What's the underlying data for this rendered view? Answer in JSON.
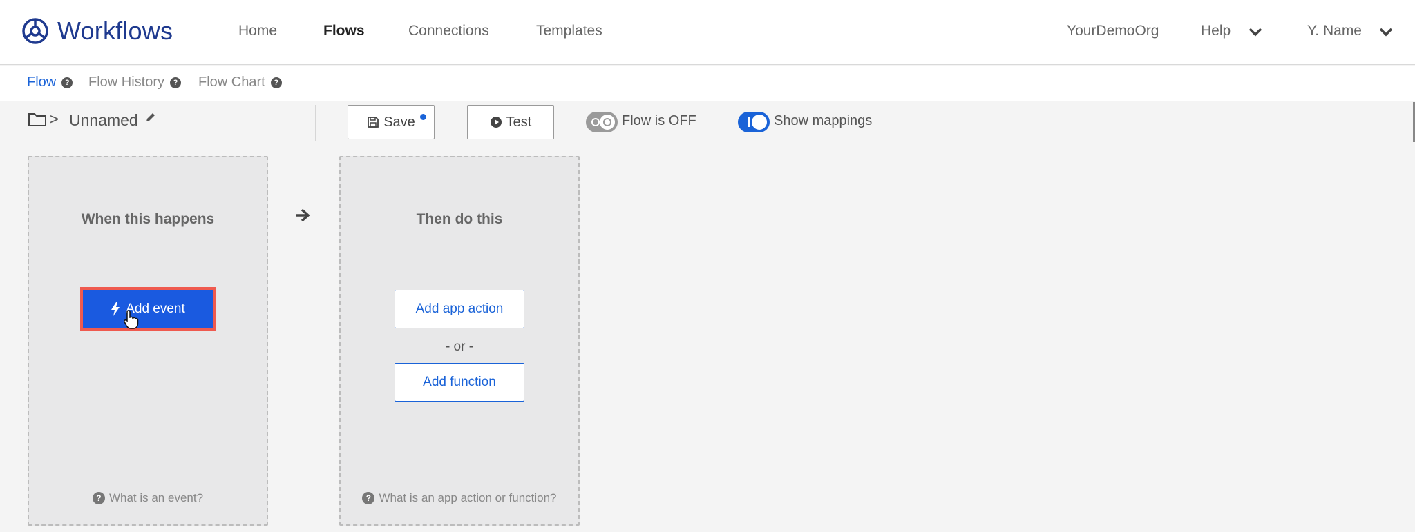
{
  "app": {
    "name": "Workflows"
  },
  "nav": {
    "home": "Home",
    "flows": "Flows",
    "connections": "Connections",
    "templates": "Templates",
    "org": "YourDemoOrg",
    "help": "Help",
    "user": "Y. Name"
  },
  "subtabs": {
    "flow": "Flow",
    "history": "Flow History",
    "chart": "Flow Chart"
  },
  "toolbar": {
    "separator": ">",
    "flow_name": "Unnamed",
    "save_label": "Save",
    "test_label": "Test",
    "flow_toggle_label": "Flow is OFF",
    "mappings_toggle_label": "Show mappings",
    "flow_toggle_on": false,
    "mappings_toggle_on": true
  },
  "trigger_card": {
    "title": "When this happens",
    "add_event_label": "Add event",
    "help_text": "What is an event?"
  },
  "action_card": {
    "title": "Then do this",
    "add_app_action_label": "Add app action",
    "or_label": "- or -",
    "add_function_label": "Add function",
    "help_text": "What is an app action or function?"
  },
  "colors": {
    "accent": "#1a63d8",
    "brand": "#1f3a8f",
    "highlight": "#ef5a4f"
  }
}
